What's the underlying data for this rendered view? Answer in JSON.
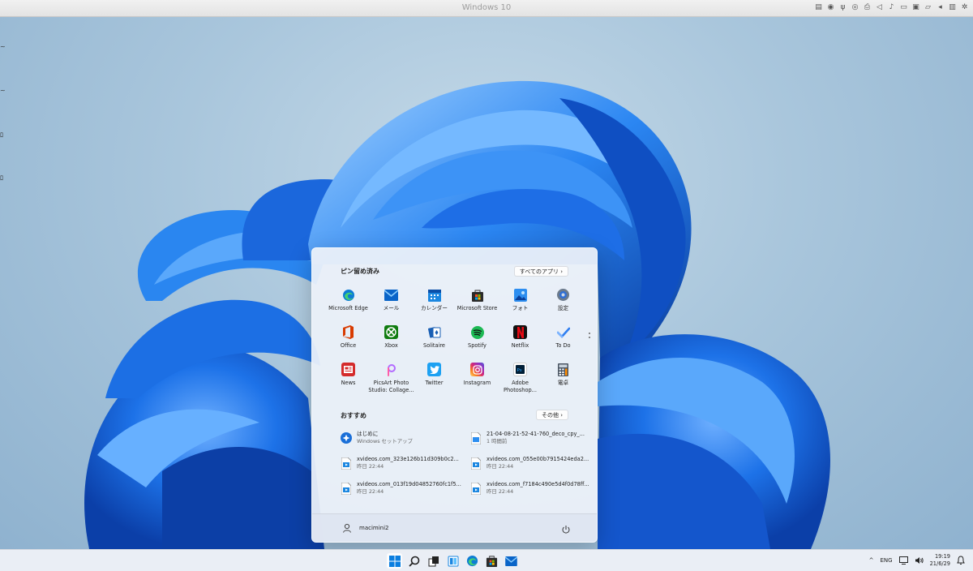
{
  "vm_bar": {
    "title": "Windows 10"
  },
  "start_menu": {
    "pinned": {
      "title": "ピン留め済み",
      "all_apps_label": "すべてのアプリ",
      "all_apps_chevron": "›",
      "apps": [
        {
          "label": "Microsoft Edge",
          "icon": "edge-icon"
        },
        {
          "label": "メール",
          "icon": "mail-icon"
        },
        {
          "label": "カレンダー",
          "icon": "calendar-icon"
        },
        {
          "label": "Microsoft Store",
          "icon": "store-icon"
        },
        {
          "label": "フォト",
          "icon": "photos-icon"
        },
        {
          "label": "設定",
          "icon": "settings-icon"
        },
        {
          "label": "Office",
          "icon": "office-icon"
        },
        {
          "label": "Xbox",
          "icon": "xbox-icon"
        },
        {
          "label": "Solitaire",
          "icon": "solitaire-icon"
        },
        {
          "label": "Spotify",
          "icon": "spotify-icon"
        },
        {
          "label": "Netflix",
          "icon": "netflix-icon"
        },
        {
          "label": "To Do",
          "icon": "todo-icon"
        },
        {
          "label": "News",
          "icon": "news-icon"
        },
        {
          "label": "PicsArt Photo Studio: Collage...",
          "icon": "picsart-icon"
        },
        {
          "label": "Twitter",
          "icon": "twitter-icon"
        },
        {
          "label": "Instagram",
          "icon": "instagram-icon"
        },
        {
          "label": "Adobe Photoshop...",
          "icon": "photoshop-icon"
        },
        {
          "label": "電卓",
          "icon": "calculator-icon"
        }
      ]
    },
    "recommended": {
      "title": "おすすめ",
      "more_label": "その他",
      "more_chevron": "›",
      "items": [
        {
          "name": "はじめに",
          "sub": "Windows セットアップ",
          "icon": "get-started-icon"
        },
        {
          "name": "21-04-08-21-52-41-760_deco_cpy_...",
          "sub": "1 時間前",
          "icon": "image-file-icon"
        },
        {
          "name": "xvideos.com_323e126b11d309b0c2...",
          "sub": "昨日 22:44",
          "icon": "video-file-icon"
        },
        {
          "name": "xvideos.com_055e00b7915424eda2...",
          "sub": "昨日 22:44",
          "icon": "video-file-icon"
        },
        {
          "name": "xvideos.com_013f19d04852760fc1f5...",
          "sub": "昨日 22:44",
          "icon": "video-file-icon"
        },
        {
          "name": "xvideos.com_f7184c490e5d4f0d78ff...",
          "sub": "昨日 22:44",
          "icon": "video-file-icon"
        }
      ]
    },
    "user": {
      "name": "macimini2"
    }
  },
  "taskbar": {
    "apps": [
      "start-icon",
      "search-icon",
      "task-view-icon",
      "widgets-icon",
      "edge-icon",
      "store-icon",
      "mail-icon"
    ],
    "tray": {
      "chevron": "^",
      "language": "ENG"
    },
    "clock": {
      "time": "19:19",
      "date": "21/6/29"
    }
  },
  "colors": {
    "accent": "#0a64c8",
    "wallpaper_bloom": "#1a6fe0",
    "netflix": "#e50914",
    "spotify": "#1db954",
    "xbox": "#107c10",
    "office": "#d83b01"
  }
}
